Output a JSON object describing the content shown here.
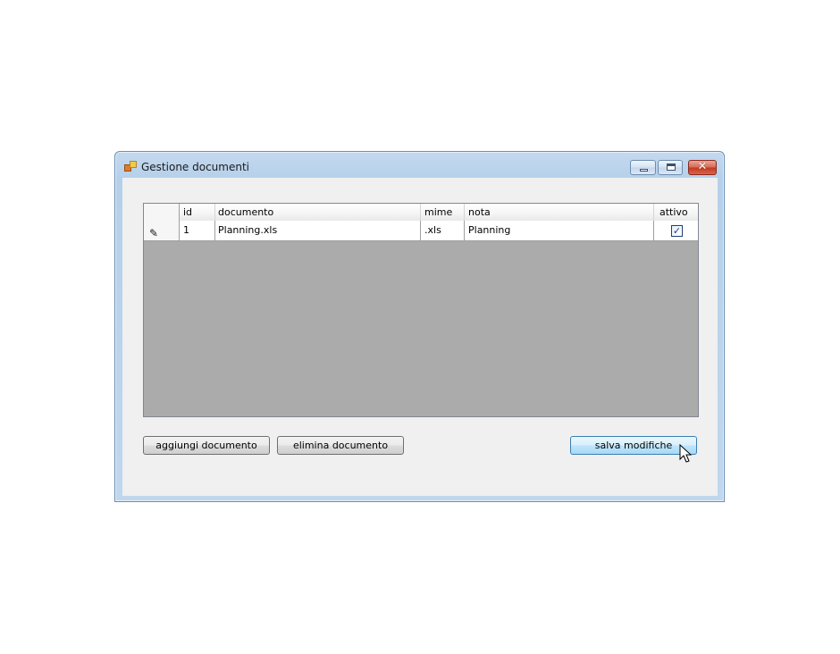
{
  "window": {
    "title": "Gestione documenti",
    "icon": "app-icon",
    "controls": [
      "minimize-icon",
      "maximize-icon",
      "close-icon"
    ]
  },
  "grid": {
    "columns": [
      "id",
      "documento",
      "mime",
      "nota",
      "attivo"
    ],
    "rows": [
      {
        "id": "1",
        "documento": "Planning.xls",
        "mime": ".xls",
        "nota": "Planning",
        "attivo": true
      }
    ],
    "row_header_icon": "pencil-icon",
    "colors": {
      "empty_area": "#ababab",
      "header_bg": "#f4f4f4",
      "cell_bg": "#ffffff"
    }
  },
  "buttons": {
    "add_label": "aggiungi documento",
    "delete_label": "elimina documento",
    "save_label": "salva modifiche"
  },
  "colors": {
    "title_bar": "#c3d9ef",
    "client_bg": "#f0f0f0",
    "save_hover": "#bee6fd"
  }
}
